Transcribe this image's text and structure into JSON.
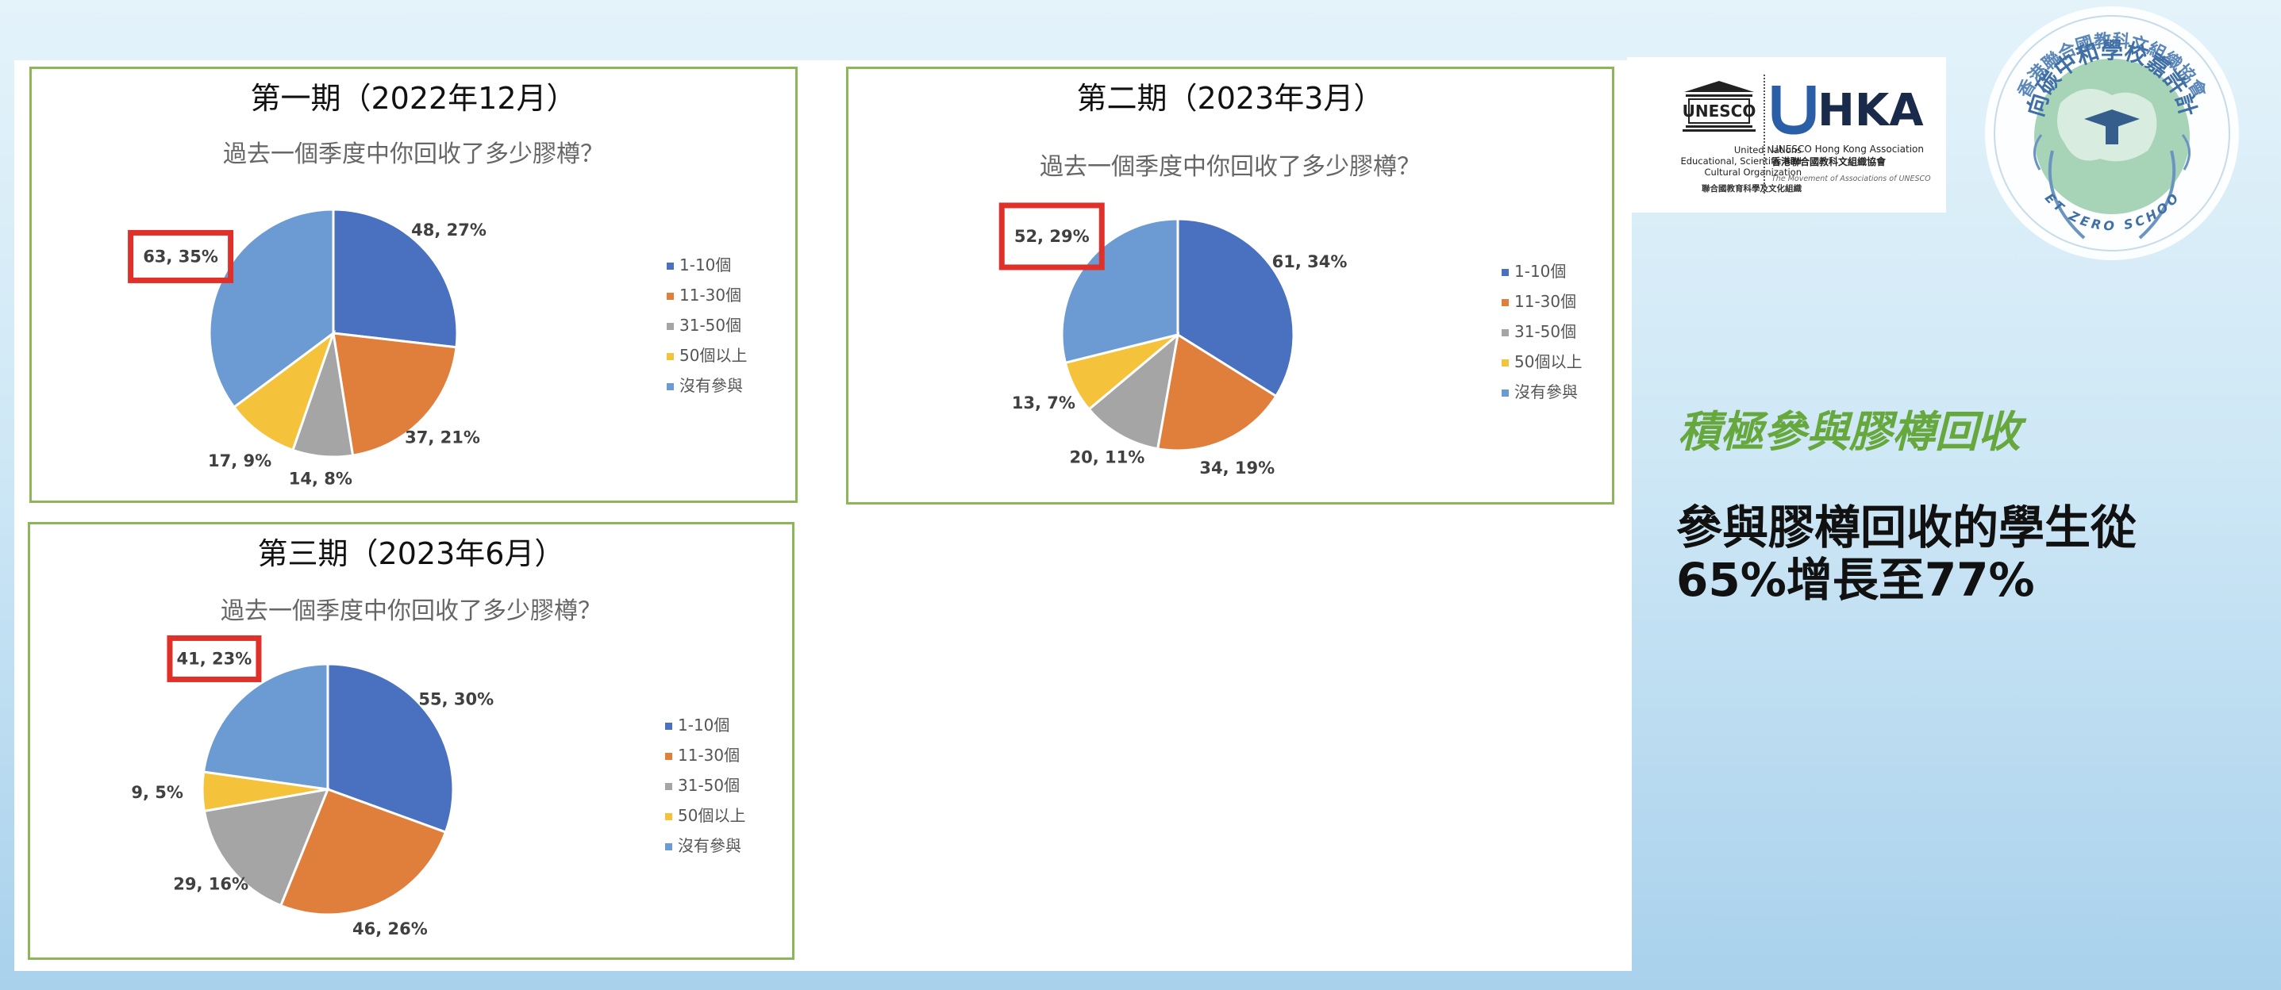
{
  "chart_data": [
    {
      "type": "pie",
      "title": "第一期（2022年12月）",
      "subtitle": "過去一個季度中你回收了多少膠樽？",
      "categories": [
        "1-10個",
        "11-30個",
        "31-50個",
        "50個以上",
        "沒有參與"
      ],
      "values": [
        48,
        37,
        14,
        17,
        63
      ],
      "percents": [
        "27%",
        "21%",
        "8%",
        "9%",
        "35%"
      ],
      "labels": [
        "48, 27%",
        "37, 21%",
        "14, 8%",
        "17, 9%",
        "63, 35%"
      ],
      "highlighted_label": "63, 35%",
      "legend_position": "right"
    },
    {
      "type": "pie",
      "title": "第二期（2023年3月）",
      "subtitle": "過去一個季度中你回收了多少膠樽？",
      "categories": [
        "1-10個",
        "11-30個",
        "31-50個",
        "50個以上",
        "沒有參與"
      ],
      "values": [
        61,
        34,
        20,
        13,
        52
      ],
      "percents": [
        "34%",
        "19%",
        "11%",
        "7%",
        "29%"
      ],
      "labels": [
        "61, 34%",
        "34, 19%",
        "20, 11%",
        "13, 7%",
        "52, 29%"
      ],
      "highlighted_label": "52, 29%",
      "legend_position": "right"
    },
    {
      "type": "pie",
      "title": "第三期（2023年6月）",
      "subtitle": "過去一個季度中你回收了多少膠樽？",
      "categories": [
        "1-10個",
        "11-30個",
        "31-50個",
        "50個以上",
        "沒有參與"
      ],
      "values": [
        55,
        46,
        29,
        9,
        41
      ],
      "percents": [
        "30%",
        "26%",
        "16%",
        "5%",
        "23%"
      ],
      "labels": [
        "55, 30%",
        "46, 26%",
        "29, 16%",
        "9, 5%",
        "41, 23%"
      ],
      "highlighted_label": "41, 23%",
      "legend_position": "right"
    }
  ],
  "colors": {
    "series": [
      "#4a70c0",
      "#e07f3c",
      "#a5a5a5",
      "#f4c23b",
      "#6b9bd2"
    ],
    "panel_border": "#8db55a",
    "highlight_box": "#e0302a",
    "headline": "#67a83e"
  },
  "logos": {
    "unesco_mark": "UNESCO",
    "unesco_lines": [
      "United Nations",
      "Educational, Scientific and",
      "Cultural Organization"
    ],
    "unesco_cn": "聯合國教育科學及文化組織",
    "uhka_mark": "UHKA",
    "uhka_en": "UNESCO Hong Kong Association",
    "uhka_cn": "香港聯合國教科文組織協會",
    "uhka_tagline": "The Movement of Associations of UNESCO",
    "badge_ring_text": "香港聯合國教科文組織協會",
    "badge_main_text": "邁向碳中和學校嘉許計劃",
    "badge_bottom_text": "NET ZERO SCHOOL"
  },
  "side": {
    "headline": "積極參與膠樽回收",
    "desc_line1": "參與膠樽回收的學生從",
    "desc_line2": "65%增長至77%"
  }
}
